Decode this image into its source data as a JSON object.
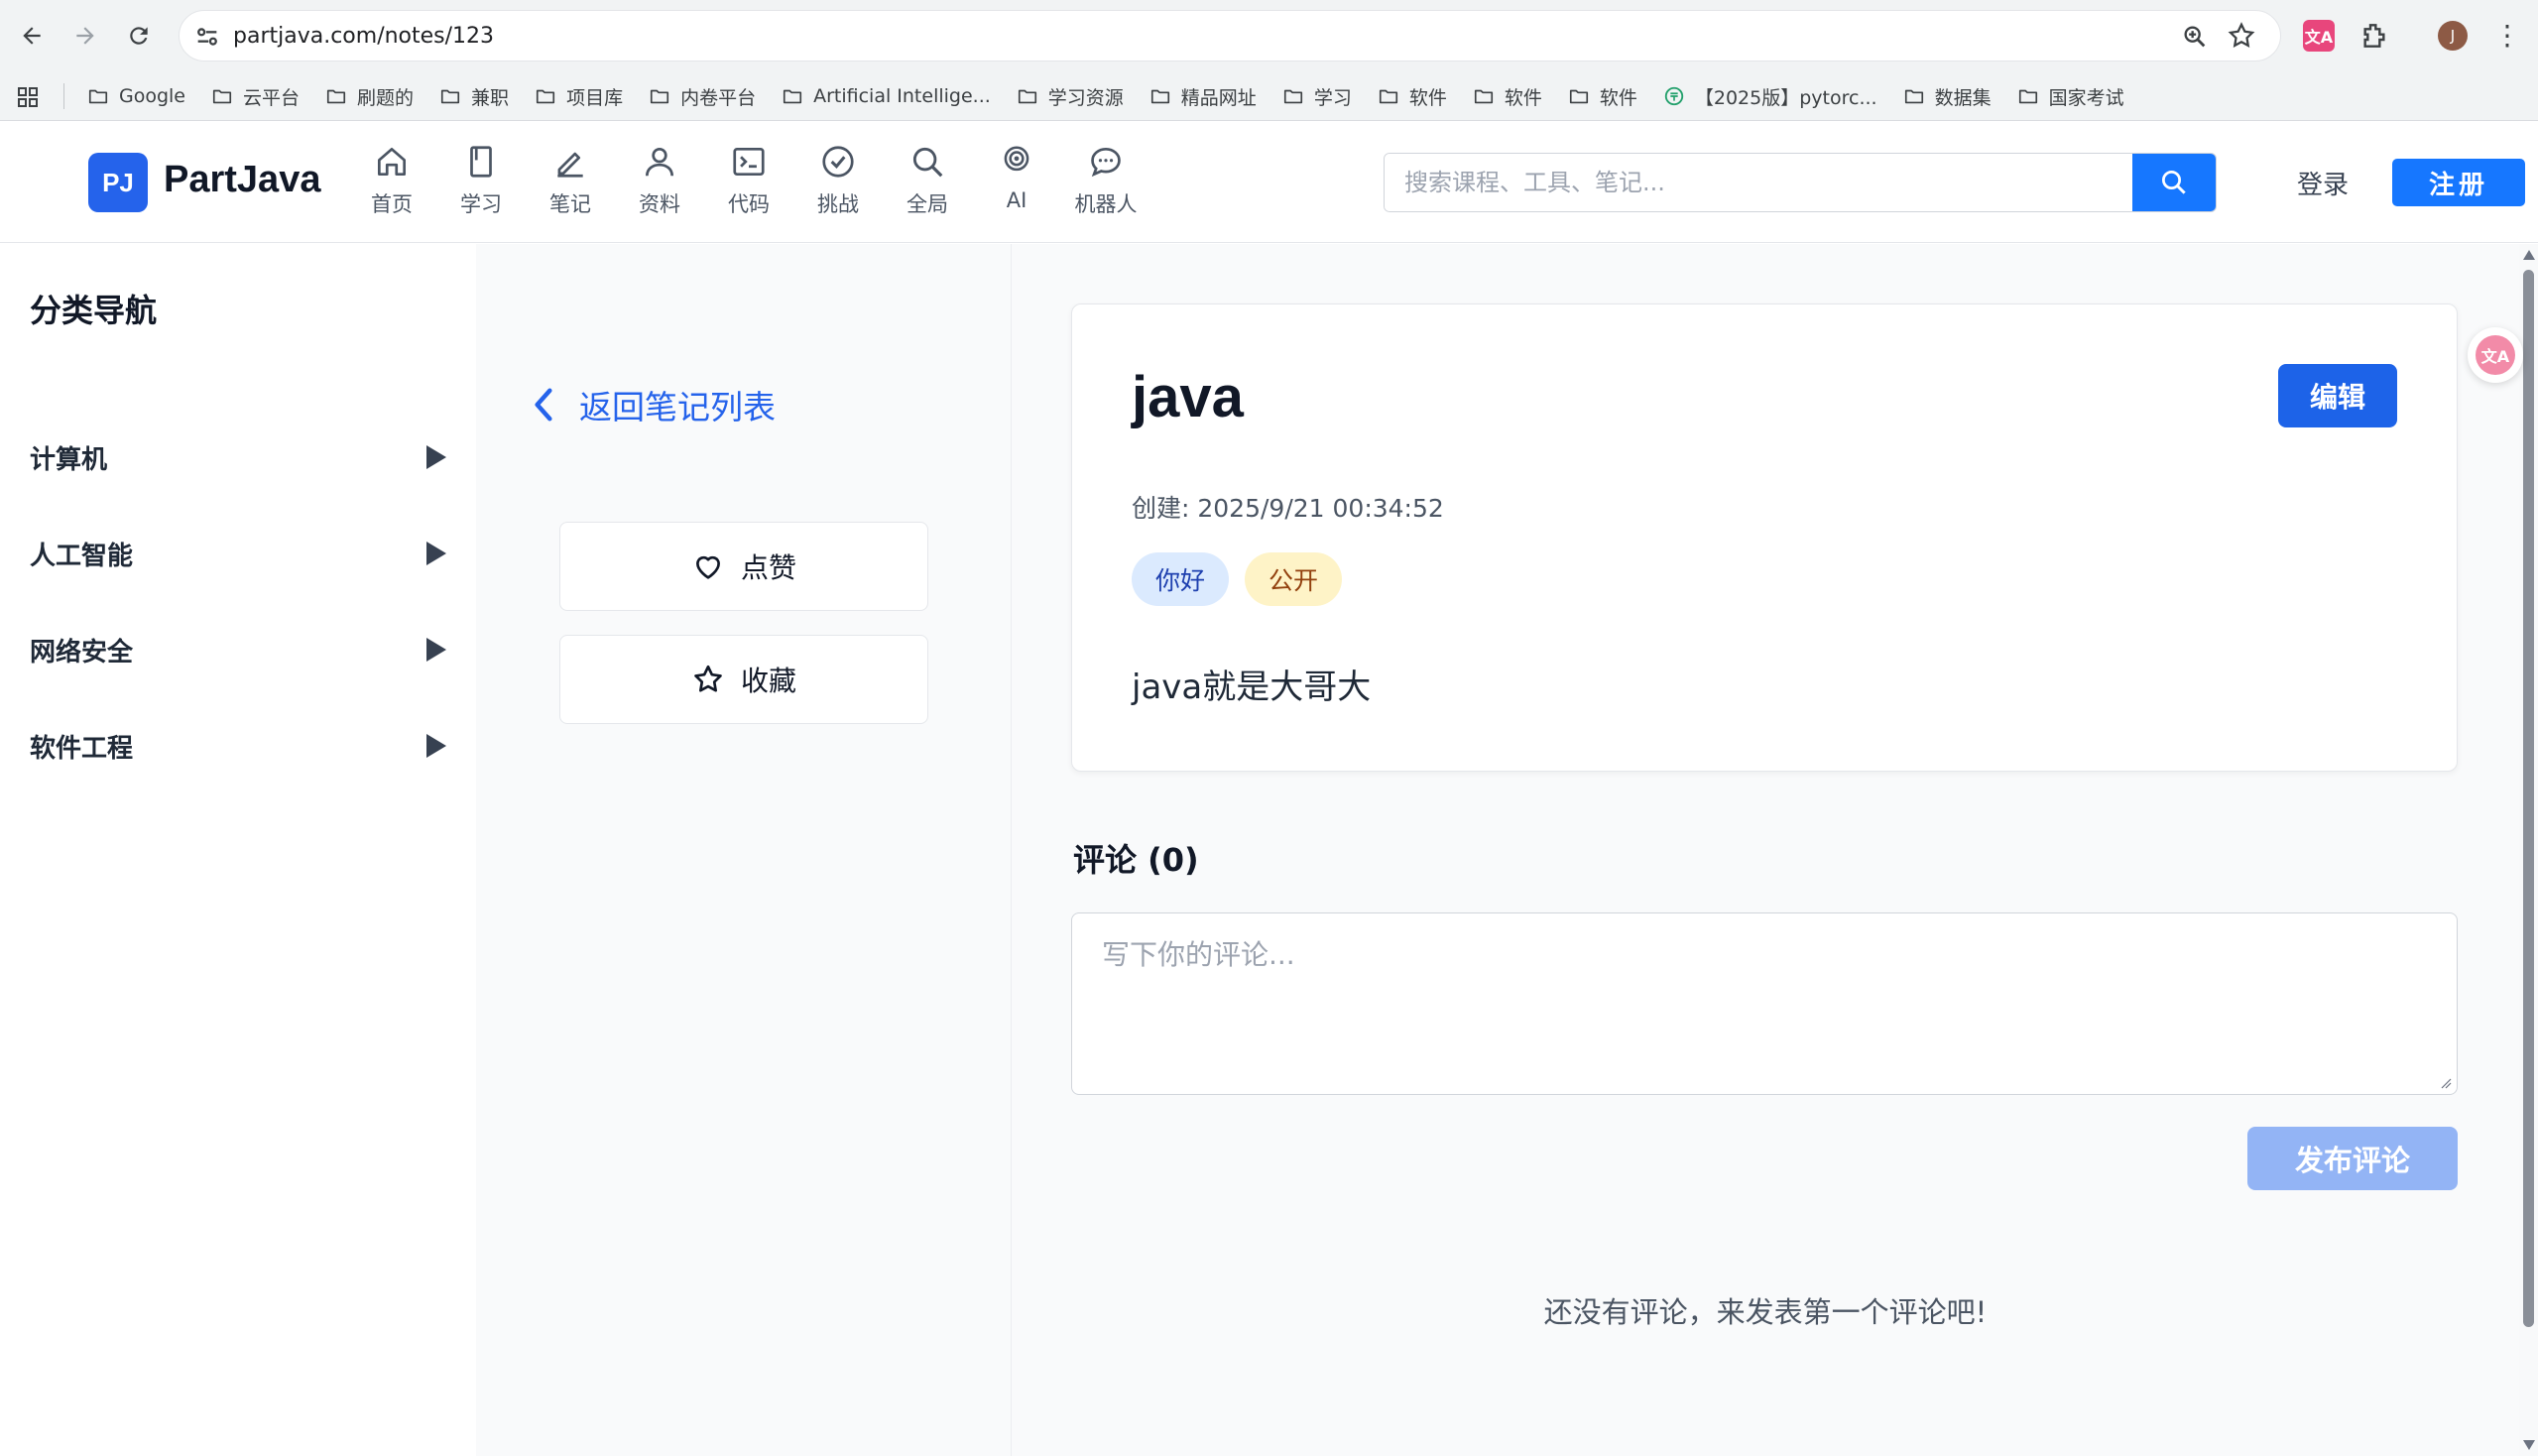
{
  "browser": {
    "url": "partjava.com/notes/123",
    "profile_initial": "J",
    "translate_ext_label": "文A",
    "bookmarks": [
      {
        "label": "Google",
        "icon": "folder-icon"
      },
      {
        "label": "云平台",
        "icon": "folder-icon"
      },
      {
        "label": "刷题的",
        "icon": "folder-icon"
      },
      {
        "label": "兼职",
        "icon": "folder-icon"
      },
      {
        "label": "项目库",
        "icon": "folder-icon"
      },
      {
        "label": "内卷平台",
        "icon": "folder-icon"
      },
      {
        "label": "Artificial Intellige...",
        "icon": "folder-icon"
      },
      {
        "label": "学习资源",
        "icon": "folder-icon"
      },
      {
        "label": "精品网址",
        "icon": "folder-icon"
      },
      {
        "label": "学习",
        "icon": "folder-icon"
      },
      {
        "label": "软件",
        "icon": "folder-icon"
      },
      {
        "label": "软件",
        "icon": "folder-icon"
      },
      {
        "label": "软件",
        "icon": "folder-icon"
      },
      {
        "label": "【2025版】pytorc...",
        "icon": "site-icon"
      },
      {
        "label": "数据集",
        "icon": "folder-icon"
      },
      {
        "label": "国家考试",
        "icon": "folder-icon"
      }
    ]
  },
  "header": {
    "logo_mark": "PJ",
    "logo_text": "PartJava",
    "nav": [
      {
        "label": "首页",
        "icon": "home-icon"
      },
      {
        "label": "学习",
        "icon": "book-icon"
      },
      {
        "label": "笔记",
        "icon": "pen-icon"
      },
      {
        "label": "资料",
        "icon": "user-icon"
      },
      {
        "label": "代码",
        "icon": "terminal-icon"
      },
      {
        "label": "挑战",
        "icon": "check-circle-icon"
      },
      {
        "label": "全局",
        "icon": "search-icon"
      },
      {
        "label": "AI",
        "icon": "ai-icon"
      },
      {
        "label": "机器人",
        "icon": "chat-icon"
      }
    ],
    "search_placeholder": "搜索课程、工具、笔记...",
    "login_label": "登录",
    "register_label": "注册"
  },
  "sidebar": {
    "title": "分类导航",
    "categories": [
      {
        "label": "计算机"
      },
      {
        "label": "人工智能"
      },
      {
        "label": "网络安全"
      },
      {
        "label": "软件工程"
      }
    ]
  },
  "actions": {
    "back_label": "返回笔记列表",
    "like_label": "点赞",
    "favorite_label": "收藏"
  },
  "note": {
    "title": "java",
    "edit_label": "编辑",
    "created": "创建: 2025/9/21 00:34:52",
    "tags": [
      {
        "label": "你好",
        "color": "#dbeafe"
      },
      {
        "label": "公开",
        "color": "#fef3c7"
      }
    ],
    "body": "java就是大哥大"
  },
  "comments": {
    "title": "评论 (0)",
    "placeholder": "写下你的评论...",
    "submit_label": "发布评论",
    "empty_message": "还没有评论，来发表第一个评论吧!"
  },
  "colors": {
    "brand": "#2563eb",
    "primary_button": "#1677ff",
    "disabled_button": "#93b4f5"
  }
}
